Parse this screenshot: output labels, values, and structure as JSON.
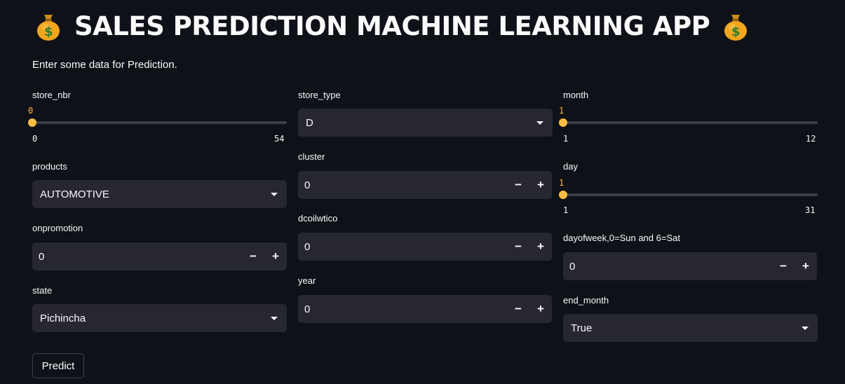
{
  "app": {
    "title": "SALES PREDICTION MACHINE LEARNING APP",
    "title_icon": "money-bag-icon",
    "subtitle": "Enter some data for Prediction."
  },
  "colors": {
    "background": "#0e1117",
    "widget": "#262730",
    "accent": "#ffbd45",
    "text": "#fafafa"
  },
  "form": {
    "store_nbr": {
      "label": "store_nbr",
      "value": "0",
      "min": "0",
      "max": "54"
    },
    "products": {
      "label": "products",
      "value": "AUTOMOTIVE"
    },
    "onpromotion": {
      "label": "onpromotion",
      "value": "0",
      "minus": "−",
      "plus": "+"
    },
    "state": {
      "label": "state",
      "value": "Pichincha"
    },
    "store_type": {
      "label": "store_type",
      "value": "D"
    },
    "cluster": {
      "label": "cluster",
      "value": "0",
      "minus": "−",
      "plus": "+"
    },
    "dcoilwtico": {
      "label": "dcoilwtico",
      "value": "0",
      "minus": "−",
      "plus": "+"
    },
    "year": {
      "label": "year",
      "value": "0",
      "minus": "−",
      "plus": "+"
    },
    "month": {
      "label": "month",
      "value": "1",
      "min": "1",
      "max": "12"
    },
    "day": {
      "label": "day",
      "value": "1",
      "min": "1",
      "max": "31"
    },
    "dayofweek": {
      "label": "dayofweek,0=Sun and 6=Sat",
      "value": "0",
      "minus": "−",
      "plus": "+"
    },
    "end_month": {
      "label": "end_month",
      "value": "True"
    }
  },
  "predict_button": {
    "label": "Predict"
  }
}
